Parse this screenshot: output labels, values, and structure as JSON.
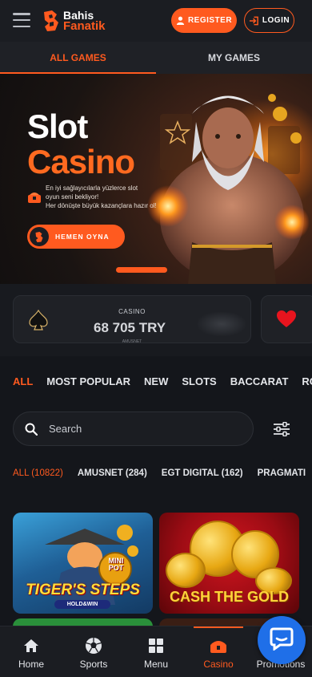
{
  "header": {
    "logo_line1": "Bahis",
    "logo_line2": "Fanatik",
    "register_label": "REGISTER",
    "login_label": "LOGIN"
  },
  "tabs": [
    {
      "label": "ALL GAMES",
      "active": true
    },
    {
      "label": "MY GAMES",
      "active": false
    }
  ],
  "banner": {
    "title_line1": "Slot",
    "title_line2": "Casino",
    "description": [
      "En iyi sağlayıcılarla yüzlerce slot",
      "oyun seni bekliyor!",
      "Her dönüşte büyük kazançlara hazır ol!"
    ],
    "cta_label": "HEMEN OYNA"
  },
  "jackpot": {
    "label": "CASINO",
    "amount": "68 705 TRY",
    "sublabel": "AMUSNET"
  },
  "categories": [
    {
      "label": "ALL",
      "active": true
    },
    {
      "label": "MOST POPULAR",
      "active": false
    },
    {
      "label": "NEW",
      "active": false
    },
    {
      "label": "SLOTS",
      "active": false
    },
    {
      "label": "BACCARAT",
      "active": false
    },
    {
      "label": "RO",
      "active": false
    }
  ],
  "search": {
    "placeholder": "Search"
  },
  "providers": [
    {
      "label": "ALL (10822)",
      "active": true
    },
    {
      "label": "AMUSNET (284)",
      "active": false
    },
    {
      "label": "EGT DIGITAL (162)",
      "active": false
    },
    {
      "label": "PRAGMATI",
      "active": false
    }
  ],
  "games": [
    {
      "title": "TIGER'S STEPS",
      "subtitle": "HOLD&WIN",
      "badge": "MINI POT"
    },
    {
      "title": "CASH THE GOLD"
    }
  ],
  "bottom_nav": [
    {
      "label": "Home",
      "icon": "home-icon",
      "active": false
    },
    {
      "label": "Sports",
      "icon": "soccer-ball-icon",
      "active": false
    },
    {
      "label": "Menu",
      "icon": "grid-icon",
      "active": false
    },
    {
      "label": "Casino",
      "icon": "casino-chest-icon",
      "active": true
    },
    {
      "label": "Promotions",
      "icon": "gift-icon",
      "active": false
    }
  ],
  "colors": {
    "accent": "#ff5a1f",
    "background": "#14161b",
    "chat": "#1f6fe8"
  }
}
